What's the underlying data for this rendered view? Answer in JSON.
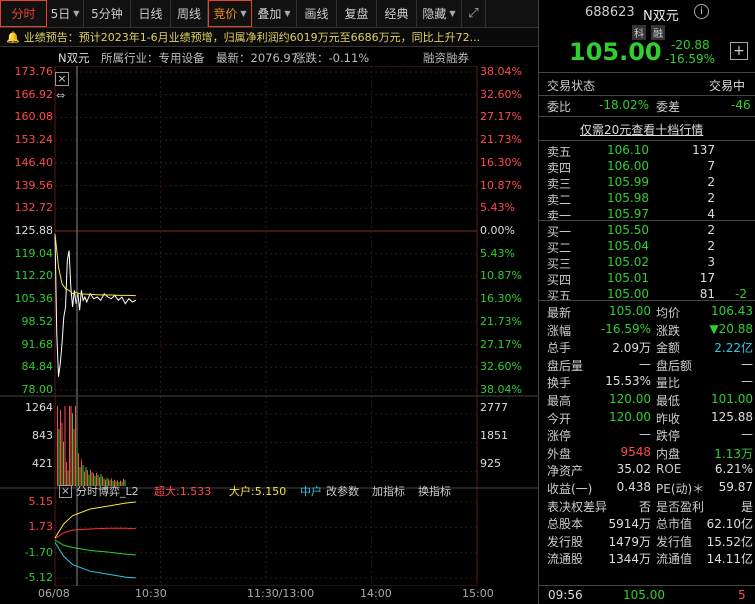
{
  "toolbar": {
    "tabs": [
      {
        "label": "分时",
        "caret": false
      },
      {
        "label": "5日",
        "caret": true
      },
      {
        "label": "5分钟",
        "caret": false
      },
      {
        "label": "日线",
        "caret": false
      },
      {
        "label": "周线",
        "caret": false
      },
      {
        "label": "竞价",
        "caret": true
      },
      {
        "label": "叠加",
        "caret": true
      },
      {
        "label": "画线",
        "caret": false
      },
      {
        "label": "复盘",
        "caret": false
      },
      {
        "label": "经典",
        "caret": false
      },
      {
        "label": "隐藏",
        "caret": true
      }
    ],
    "expand_icon": "expand-icon"
  },
  "banner": {
    "icon": "bell-icon",
    "text": "业绩预告：预计2023年1-6月业绩预增，归属净利润约6019万元至6686万元，同比上升72..."
  },
  "chart_header": {
    "name": "N双元",
    "industry": "所属行业：专用设备",
    "latest": "最新：2076.97",
    "change": "涨跌：-0.11%",
    "toggle": "融资融券"
  },
  "chart_data": {
    "type": "line",
    "price_axis": {
      "labels": [
        "173.76",
        "166.92",
        "160.08",
        "153.24",
        "146.40",
        "139.56",
        "132.72",
        "125.88",
        "119.04",
        "112.20",
        "105.36",
        "98.52",
        "91.68",
        "84.84",
        "78.00"
      ],
      "pct_labels": [
        "38.04%",
        "32.60%",
        "27.17%",
        "21.73%",
        "16.30%",
        "10.87%",
        "5.43%",
        "0.00%",
        "5.43%",
        "10.87%",
        "16.30%",
        "21.73%",
        "27.17%",
        "32.60%",
        "38.04%"
      ],
      "min": 78.0,
      "max": 173.76,
      "prev_close": 125.88
    },
    "time_labels": [
      "06/08",
      "10:30",
      "11:30/13:00",
      "14:00",
      "15:00"
    ],
    "x_range_minutes": [
      0,
      240
    ],
    "series": [
      {
        "name": "price",
        "color": "#ffffff",
        "x": [
          0,
          1,
          2,
          3,
          4,
          5,
          6,
          7,
          8,
          9,
          10,
          11,
          12,
          13,
          14,
          15,
          16,
          17,
          18,
          20,
          22,
          24,
          26,
          28,
          30,
          32,
          34,
          36,
          38,
          40,
          42,
          44,
          46
        ],
        "y": [
          125.0,
          95.0,
          82.0,
          86.0,
          92.0,
          100.0,
          103.0,
          117.0,
          120.0,
          109.0,
          103.0,
          108.0,
          104.0,
          107.0,
          102.0,
          108.0,
          105.0,
          106.0,
          104.5,
          107.0,
          105.5,
          106.0,
          105.0,
          107.0,
          106.0,
          105.5,
          106.5,
          105.0,
          106.0,
          104.0,
          105.5,
          104.5,
          105.0
        ]
      },
      {
        "name": "avg",
        "color": "#f5e642",
        "x": [
          0,
          2,
          4,
          6,
          8,
          10,
          12,
          14,
          16,
          20,
          24,
          28,
          32,
          36,
          40,
          44,
          46
        ],
        "y": [
          125.0,
          115.0,
          110.0,
          108.5,
          108.0,
          107.0,
          107.5,
          107.0,
          106.9,
          106.8,
          106.7,
          106.6,
          106.6,
          106.5,
          106.5,
          106.45,
          106.43
        ]
      }
    ],
    "volume_panel": {
      "left_labels": [
        "1264",
        "843",
        "421"
      ],
      "right_labels": [
        "2777",
        "1851",
        "925"
      ],
      "max": 1264,
      "bars": [
        1264,
        900,
        1200,
        1000,
        700,
        1264,
        380,
        250,
        1264,
        1264,
        1150,
        900,
        1264,
        720,
        520,
        300,
        420,
        330,
        230,
        300,
        250,
        180,
        260,
        220,
        200,
        160,
        210,
        170,
        140,
        190,
        150,
        120,
        100,
        130,
        110,
        90,
        120,
        80,
        100,
        75,
        90,
        60,
        85,
        70,
        110,
        95
      ]
    },
    "indicator_panel": {
      "title": "分时博弈_L2",
      "super_large": "超大:1.533",
      "large": "大户:5.150",
      "small_prefix": "中户",
      "buttons": [
        "改参数",
        "加指标",
        "换指标"
      ],
      "labels": [
        "5.15",
        "1.73",
        "-1.70",
        "-5.12"
      ],
      "min": -5.12,
      "max": 5.15,
      "series": [
        {
          "name": "超大",
          "color": "#ff3030",
          "x": [
            0,
            5,
            10,
            20,
            30,
            40,
            46
          ],
          "y": [
            0.2,
            1.0,
            1.35,
            1.5,
            1.6,
            1.6,
            1.533
          ]
        },
        {
          "name": "大户",
          "color": "#f5e642",
          "x": [
            0,
            5,
            10,
            20,
            30,
            40,
            46
          ],
          "y": [
            0.3,
            2.2,
            3.3,
            4.2,
            4.6,
            5.0,
            5.15
          ]
        },
        {
          "name": "中户",
          "color": "#2fcf2f",
          "x": [
            0,
            5,
            10,
            20,
            30,
            40,
            46
          ],
          "y": [
            0.0,
            -0.7,
            -1.0,
            -1.4,
            -1.6,
            -1.9,
            -2.0
          ]
        },
        {
          "name": "小户",
          "color": "#2ec8e8",
          "x": [
            0,
            5,
            10,
            20,
            30,
            40,
            46
          ],
          "y": [
            -0.3,
            -2.2,
            -3.3,
            -4.2,
            -4.6,
            -5.0,
            -5.1
          ]
        }
      ]
    }
  },
  "quote": {
    "code": "688623",
    "name": "N双元",
    "info_icon": "info-icon",
    "tag_ke": "科",
    "tag_rong": "融",
    "price": "105.00",
    "change": "-20.88",
    "change_pct": "-16.59%",
    "add_icon": "plus-icon",
    "status_label": "交易状态",
    "status_value": "交易中",
    "ratio_label": "委比",
    "ratio_value": "-18.02%",
    "diff_label": "委差",
    "diff_value": "-46",
    "promo": "仅需20元查看十档行情",
    "asks": [
      {
        "label": "卖五",
        "price": "106.10",
        "vol": "137"
      },
      {
        "label": "卖四",
        "price": "106.00",
        "vol": "7"
      },
      {
        "label": "卖三",
        "price": "105.99",
        "vol": "2"
      },
      {
        "label": "卖二",
        "price": "105.98",
        "vol": "2"
      },
      {
        "label": "卖一",
        "price": "105.97",
        "vol": "4"
      }
    ],
    "bids": [
      {
        "label": "买一",
        "price": "105.50",
        "vol": "2",
        "extra": ""
      },
      {
        "label": "买二",
        "price": "105.04",
        "vol": "2",
        "extra": ""
      },
      {
        "label": "买三",
        "price": "105.02",
        "vol": "3",
        "extra": ""
      },
      {
        "label": "买四",
        "price": "105.01",
        "vol": "17",
        "extra": ""
      },
      {
        "label": "买五",
        "price": "105.00",
        "vol": "81",
        "extra": "-2"
      }
    ],
    "stats": [
      {
        "l1": "最新",
        "v1": "105.00",
        "c1": "green",
        "l2": "均价",
        "v2": "106.43",
        "c2": "green"
      },
      {
        "l1": "涨幅",
        "v1": "-16.59%",
        "c1": "green",
        "l2": "涨跌",
        "v2": "▼20.88",
        "c2": "green"
      },
      {
        "l1": "总手",
        "v1": "2.09万",
        "c1": "white",
        "l2": "金额",
        "v2": "2.22亿",
        "c2": "cyan"
      },
      {
        "l1": "盘后量",
        "v1": "—",
        "c1": "white",
        "l2": "盘后额",
        "v2": "—",
        "c2": "white"
      },
      {
        "l1": "换手",
        "v1": "15.53%",
        "c1": "white",
        "l2": "量比",
        "v2": "—",
        "c2": "white"
      },
      {
        "l1": "最高",
        "v1": "120.00",
        "c1": "green",
        "l2": "最低",
        "v2": "101.00",
        "c2": "green"
      },
      {
        "l1": "今开",
        "v1": "120.00",
        "c1": "green",
        "l2": "昨收",
        "v2": "125.88",
        "c2": "white"
      },
      {
        "l1": "涨停",
        "v1": "—",
        "c1": "white",
        "l2": "跌停",
        "v2": "—",
        "c2": "white"
      },
      {
        "l1": "外盘",
        "v1": "9548",
        "c1": "red",
        "l2": "内盘",
        "v2": "1.13万",
        "c2": "green"
      },
      {
        "l1": "净资产",
        "v1": "35.02",
        "c1": "white",
        "l2": "ROE",
        "v2": "6.21%",
        "c2": "white"
      },
      {
        "l1": "收益(一)",
        "v1": "0.438",
        "c1": "white",
        "l2": "PE(动)＊",
        "v2": "59.87",
        "c2": "white"
      },
      {
        "l1": "表决权差异",
        "v1": "否",
        "c1": "white",
        "l2": "是否盈利",
        "v2": "是",
        "c2": "white"
      },
      {
        "l1": "总股本",
        "v1": "5914万",
        "c1": "white",
        "l2": "总市值",
        "v2": "62.10亿",
        "c2": "white"
      },
      {
        "l1": "发行股",
        "v1": "1479万",
        "c1": "white",
        "l2": "发行值",
        "v2": "15.52亿",
        "c2": "white"
      },
      {
        "l1": "流通股",
        "v1": "1344万",
        "c1": "white",
        "l2": "流通值",
        "v2": "14.11亿",
        "c2": "white"
      }
    ],
    "last_trade": {
      "time": "09:56",
      "price": "105.00",
      "vol": "5"
    }
  },
  "colors": {
    "up": "#ff4a4a",
    "down": "#2fcf2f",
    "avg": "#f5e642",
    "accent": "#e8432f",
    "cyan": "#2ec8e8"
  }
}
